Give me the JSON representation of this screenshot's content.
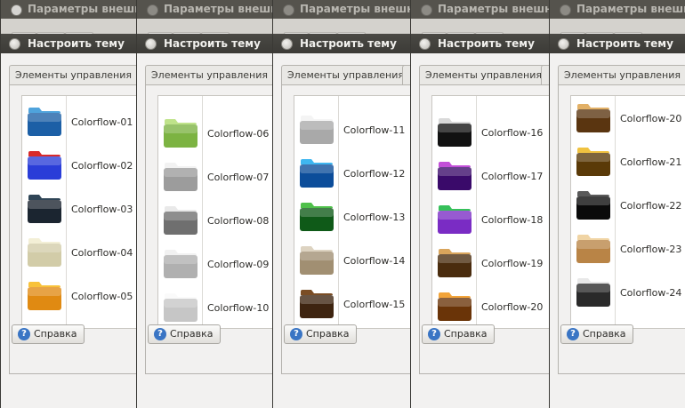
{
  "bg_window_title": "Параметры внешнего вида",
  "dialog_title": "Настроить тему",
  "tab_label": "Элементы управления",
  "help_button_label": "Справка",
  "panes": [
    {
      "items": [
        {
          "label": "Colorflow-01",
          "icon": "blue-floral-folder-icon",
          "colors": [
            "#4fa3dc",
            "#1c5fa6"
          ]
        },
        {
          "label": "Colorflow-02",
          "icon": "mosaic-folder-icon",
          "colors": [
            "#d82a2a",
            "#2a3dd8"
          ]
        },
        {
          "label": "Colorflow-03",
          "icon": "dark-floral-folder-icon",
          "colors": [
            "#2f4556",
            "#1b2530"
          ]
        },
        {
          "label": "Colorflow-04",
          "icon": "cream-floral-folder-icon",
          "colors": [
            "#f3efd6",
            "#d2cca8"
          ]
        },
        {
          "label": "Colorflow-05",
          "icon": "orange-flower-folder-icon",
          "colors": [
            "#f8c23a",
            "#e08a12"
          ]
        }
      ]
    },
    {
      "items": [
        {
          "label": "Colorflow-06",
          "icon": "green-folder-icon",
          "colors": [
            "#bfe38a",
            "#7cb342"
          ]
        },
        {
          "label": "Colorflow-07",
          "icon": "dotted-folder-icon",
          "colors": [
            "#f2f2f2",
            "#9c9c9c"
          ]
        },
        {
          "label": "Colorflow-08",
          "icon": "pattern-folder-icon",
          "colors": [
            "#e9e9e9",
            "#6f6f6f"
          ]
        },
        {
          "label": "Colorflow-09",
          "icon": "striped-folder-icon",
          "colors": [
            "#f1f1f1",
            "#b0b0b0"
          ]
        },
        {
          "label": "Colorflow-10",
          "icon": "grid-folder-icon",
          "colors": [
            "#fafafa",
            "#c6c6c6"
          ]
        }
      ]
    },
    {
      "items": [
        {
          "label": "Colorflow-11",
          "icon": "white-pattern-folder-icon",
          "colors": [
            "#f4f4f4",
            "#a9a9a9"
          ]
        },
        {
          "label": "Colorflow-12",
          "icon": "blue-burst-folder-icon",
          "colors": [
            "#3fb6f0",
            "#0c4d9a"
          ]
        },
        {
          "label": "Colorflow-13",
          "icon": "green-wave-folder-icon",
          "colors": [
            "#4fc04a",
            "#0f5a18"
          ]
        },
        {
          "label": "Colorflow-14",
          "icon": "beige-folder-icon",
          "colors": [
            "#ddd3c1",
            "#a18f72"
          ]
        },
        {
          "label": "Colorflow-15",
          "icon": "brown-monogram-folder-icon",
          "colors": [
            "#7a4d25",
            "#3e2410"
          ]
        }
      ]
    },
    {
      "items": [
        {
          "label": "Colorflow-16",
          "icon": "black-gradient-folder-icon",
          "colors": [
            "#d9d9d9",
            "#111111"
          ]
        },
        {
          "label": "Colorflow-17",
          "icon": "purple-folder-icon",
          "colors": [
            "#c24fd8",
            "#3a0a6a"
          ]
        },
        {
          "label": "Colorflow-18",
          "icon": "rainbow-folder-icon",
          "colors": [
            "#36c05a",
            "#7a2cc4"
          ]
        },
        {
          "label": "Colorflow-19",
          "icon": "leopard-folder-icon",
          "colors": [
            "#d9a55c",
            "#4a2c0e"
          ]
        },
        {
          "label": "Colorflow-20",
          "icon": "tiger-folder-icon",
          "colors": [
            "#f2a43a",
            "#6a3408"
          ]
        }
      ]
    },
    {
      "items": [
        {
          "label": "Colorflow-20",
          "icon": "leopard-folder-icon",
          "colors": [
            "#e2b066",
            "#5a3510"
          ]
        },
        {
          "label": "Colorflow-21",
          "icon": "cheetah-folder-icon",
          "colors": [
            "#f0c240",
            "#5a3a08"
          ]
        },
        {
          "label": "Colorflow-22",
          "icon": "black-folder-icon",
          "colors": [
            "#5a5a5a",
            "#0a0a0a"
          ]
        },
        {
          "label": "Colorflow-23",
          "icon": "sand-folder-icon",
          "colors": [
            "#f0d4a4",
            "#b98446"
          ]
        },
        {
          "label": "Colorflow-24",
          "icon": "zebra-folder-icon",
          "colors": [
            "#e8e8e8",
            "#2a2a2a"
          ]
        }
      ]
    }
  ]
}
